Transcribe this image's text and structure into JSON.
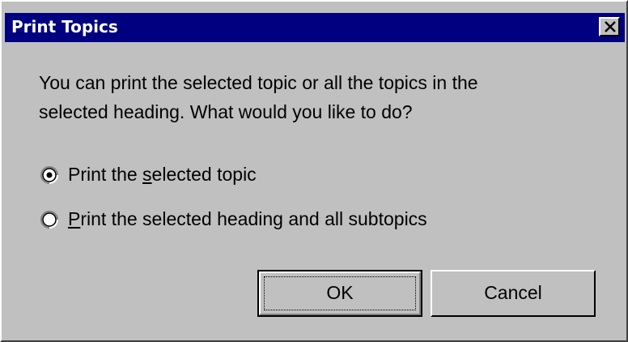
{
  "dialog": {
    "title": "Print Topics",
    "close_icon": "close-x-icon",
    "message_line1": "You can print the selected topic or all the topics in the",
    "message_line2": "selected heading. What would you like to do?"
  },
  "options": [
    {
      "label_before": "Print the ",
      "label_accel": "s",
      "label_after": "elected topic",
      "selected": true
    },
    {
      "label_before": "",
      "label_accel": "P",
      "label_after": "rint the selected heading and all subtopics",
      "selected": false
    }
  ],
  "buttons": {
    "ok_label": "OK",
    "cancel_label": "Cancel"
  },
  "colors": {
    "titlebar": "#000080",
    "face": "#c0c0c0"
  }
}
